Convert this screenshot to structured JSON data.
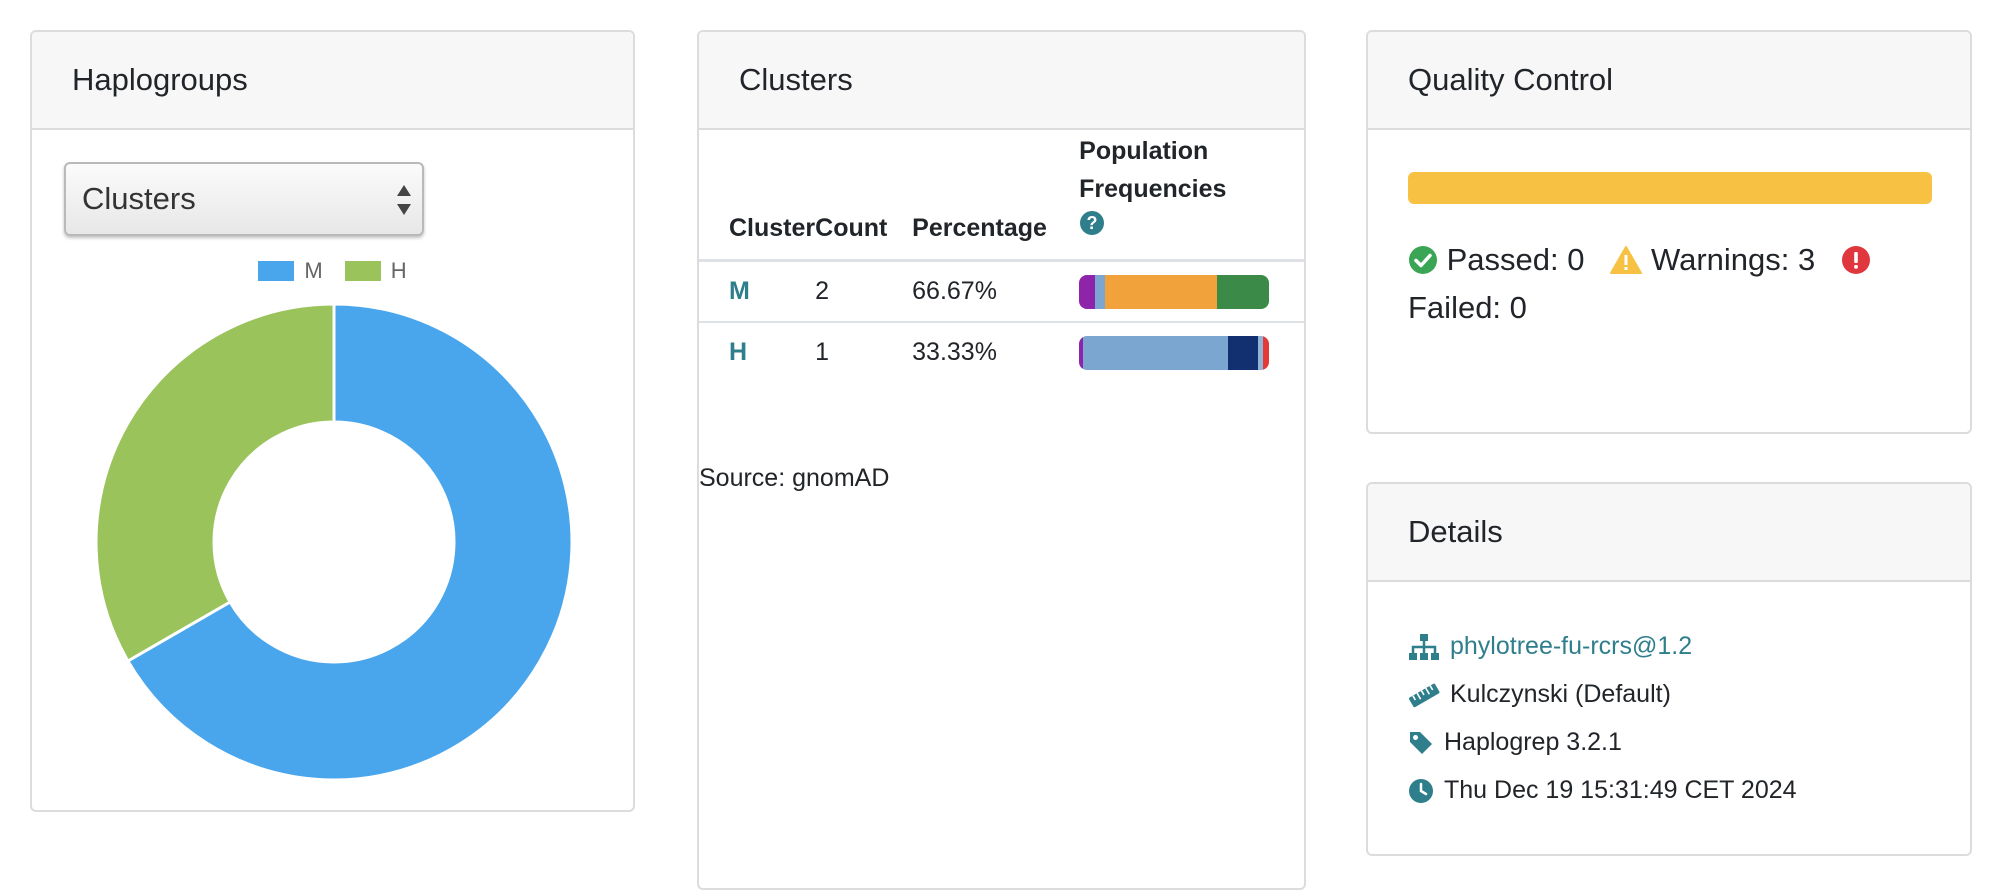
{
  "haplogroups": {
    "title": "Haplogroups",
    "select_value": "Clusters",
    "colors": {
      "M": "#4aa6ec",
      "H": "#9ac35c"
    },
    "chart_data": {
      "type": "pie",
      "categories": [
        "M",
        "H"
      ],
      "values": [
        2,
        1
      ],
      "legend": "top"
    }
  },
  "clusters": {
    "title": "Clusters",
    "headers": {
      "cluster": "Cluster",
      "count": "Count",
      "percentage": "Percentage",
      "freq1": "Population",
      "freq2": "Frequencies"
    },
    "rows": [
      {
        "cluster": "M",
        "count": "2",
        "percentage": "66.67%"
      },
      {
        "cluster": "H",
        "count": "1",
        "percentage": "33.33%"
      }
    ],
    "freq_colors": {
      "M": [
        "#8e24aa",
        "#7aa6cf",
        "#f2a23a",
        "#3b8a47"
      ],
      "H": [
        "#8e24aa",
        "#7aa6cf",
        "#12306f",
        "#8fb6d8",
        "#e53935"
      ]
    },
    "source": "Source: gnomAD"
  },
  "qc": {
    "title": "Quality Control",
    "progress_fraction": 1.0,
    "progress_color": "#f7c243",
    "passed": "Passed: 0",
    "warnings": "Warnings: 3",
    "failed": "Failed: 0"
  },
  "details": {
    "title": "Details",
    "tree": "phylotree-fu-rcrs@1.2",
    "metric": "Kulczynski (Default)",
    "version": "Haplogrep 3.2.1",
    "timestamp": "Thu Dec 19 15:31:49 CET 2024"
  }
}
